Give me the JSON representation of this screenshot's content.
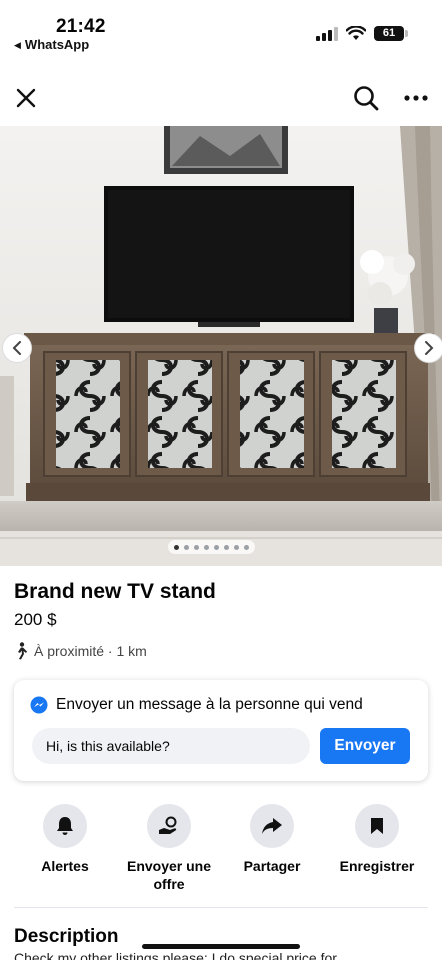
{
  "status_bar": {
    "time": "21:42",
    "back_app": "WhatsApp",
    "battery": "61"
  },
  "nav": {
    "close_icon": "close-icon",
    "search_icon": "search-icon",
    "more_icon": "more-horizontal-icon"
  },
  "carousel": {
    "photo_count": 8,
    "active_index": 0
  },
  "listing": {
    "title": "Brand new TV stand",
    "price": "200 $",
    "location": "À proximité · 1 km"
  },
  "message": {
    "heading": "Envoyer un message à la personne qui vend",
    "input_value": "Hi, is this available?",
    "send_label": "Envoyer"
  },
  "actions": [
    {
      "label": "Alertes",
      "icon": "bell-icon"
    },
    {
      "label": "Envoyer une offre",
      "icon": "offer-icon"
    },
    {
      "label": "Partager",
      "icon": "share-icon"
    },
    {
      "label": "Enregistrer",
      "icon": "bookmark-icon"
    }
  ],
  "description": {
    "heading": "Description",
    "text": "Check my other listings please; I do special price for..."
  },
  "colors": {
    "accent": "#1877f2",
    "action_circle": "#e4e6eb"
  }
}
